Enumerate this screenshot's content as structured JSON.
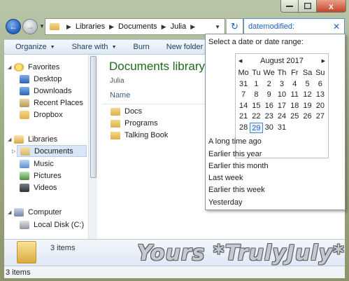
{
  "window": {
    "close_glyph": "x"
  },
  "address": {
    "crumbs": [
      "Libraries",
      "Documents",
      "Julia"
    ],
    "search_text": "datemodified:"
  },
  "toolbar": {
    "organize": "Organize",
    "share": "Share with",
    "burn": "Burn",
    "new_folder": "New folder"
  },
  "nav": {
    "favorites": "Favorites",
    "desktop": "Desktop",
    "downloads": "Downloads",
    "recent": "Recent Places",
    "dropbox": "Dropbox",
    "libraries": "Libraries",
    "documents": "Documents",
    "music": "Music",
    "pictures": "Pictures",
    "videos": "Videos",
    "computer": "Computer",
    "local_disk": "Local Disk (C:)"
  },
  "content": {
    "title": "Documents library",
    "subtitle": "Julia",
    "column_name": "Name",
    "files": [
      "Docs",
      "Programs",
      "Talking Book"
    ]
  },
  "details": {
    "count": "3 items",
    "watermark": "Yours *TrulyJuly*"
  },
  "status": {
    "text": "3 items"
  },
  "datepicker": {
    "prompt": "Select a date or date range:",
    "month": "August 2017",
    "days_of_week": [
      "Mo",
      "Tu",
      "We",
      "Th",
      "Fr",
      "Sa",
      "Su"
    ],
    "weeks": [
      [
        "31",
        "1",
        "2",
        "3",
        "4",
        "5",
        "6"
      ],
      [
        "7",
        "8",
        "9",
        "10",
        "11",
        "12",
        "13"
      ],
      [
        "14",
        "15",
        "16",
        "17",
        "18",
        "19",
        "20"
      ],
      [
        "21",
        "22",
        "23",
        "24",
        "25",
        "26",
        "27"
      ],
      [
        "28",
        "29",
        "30",
        "31",
        "",
        "",
        ""
      ]
    ],
    "today": "29",
    "ranges": [
      "A long time ago",
      "Earlier this year",
      "Earlier this month",
      "Last week",
      "Earlier this week",
      "Yesterday"
    ]
  },
  "colors": {
    "library_title": "#1e6b1e",
    "link_blue": "#1f5fbf",
    "selection": "#d9e6f7"
  }
}
